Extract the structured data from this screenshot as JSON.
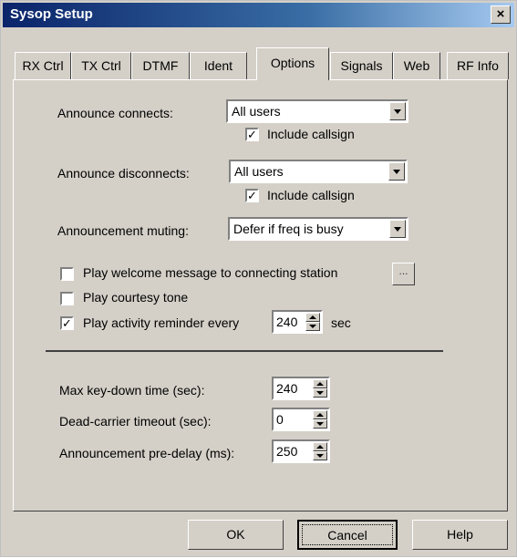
{
  "window": {
    "title": "Sysop Setup",
    "close_glyph": "×"
  },
  "tabs": [
    {
      "label": "RX Ctrl"
    },
    {
      "label": "TX Ctrl"
    },
    {
      "label": "DTMF"
    },
    {
      "label": "Ident"
    },
    {
      "label": "Options"
    },
    {
      "label": "Signals"
    },
    {
      "label": "Web"
    },
    {
      "label": "RF Info"
    }
  ],
  "active_tab": "Options",
  "options": {
    "announce_connects": {
      "label": "Announce connects:",
      "value": "All users",
      "include_callsign_label": "Include callsign",
      "include_callsign": true
    },
    "announce_disconnects": {
      "label": "Announce disconnects:",
      "value": "All users",
      "include_callsign_label": "Include callsign",
      "include_callsign": true
    },
    "announcement_muting": {
      "label": "Announcement muting:",
      "value": "Defer if freq is busy"
    },
    "play_welcome": {
      "label": "Play welcome message to connecting station",
      "checked": false,
      "browse_label": "..."
    },
    "play_courtesy": {
      "label": "Play courtesy tone",
      "checked": false
    },
    "play_activity": {
      "label": "Play activity reminder every",
      "checked": true,
      "value": "240",
      "unit": "sec"
    },
    "max_keydown": {
      "label": "Max key-down time (sec):",
      "value": "240"
    },
    "dead_carrier": {
      "label": "Dead-carrier timeout (sec):",
      "value": "0"
    },
    "pre_delay": {
      "label": "Announcement pre-delay (ms):",
      "value": "250"
    }
  },
  "check_glyph": "✓",
  "buttons": {
    "ok": "OK",
    "cancel": "Cancel",
    "help": "Help"
  },
  "colors": {
    "title_start": "#0a246a",
    "title_end": "#a6caf0",
    "face": "#d4d0c8"
  }
}
